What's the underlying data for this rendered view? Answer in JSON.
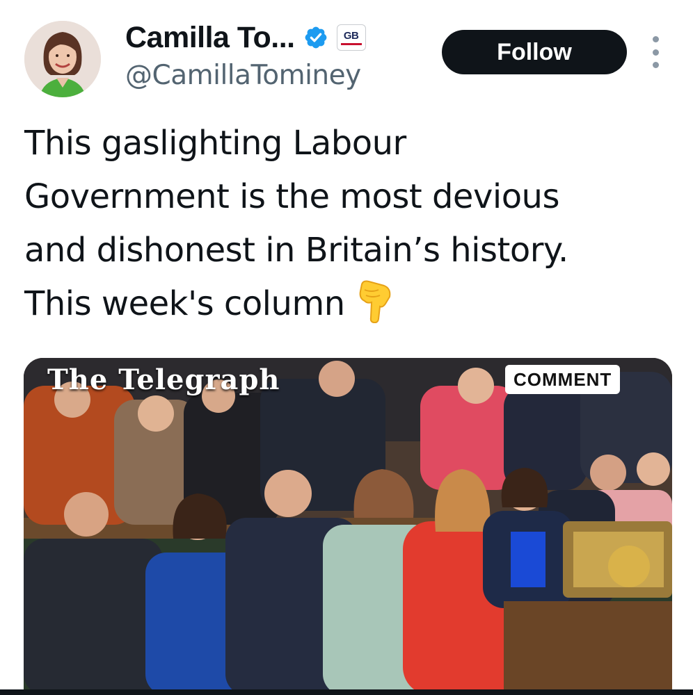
{
  "user": {
    "display_name": "Camilla To...",
    "handle": "@CamillaTominey",
    "verified_icon": "verified-badge-icon",
    "affiliate_badge": {
      "label": "GB",
      "accent": "#c8102e"
    }
  },
  "actions": {
    "follow_label": "Follow",
    "more_icon": "more-vertical-icon"
  },
  "tweet": {
    "lines": [
      "This gaslighting Labour",
      "Government is the most devious",
      "and dishonest in Britain’s history.",
      "This week's column"
    ],
    "emoji_icon": "backhand-index-pointing-down-icon"
  },
  "media": {
    "masthead": "The Telegraph",
    "label": "COMMENT"
  },
  "colors": {
    "text": "#0f1419",
    "secondary": "#536471",
    "verified": "#1d9bf0",
    "button": "#0f1419"
  }
}
